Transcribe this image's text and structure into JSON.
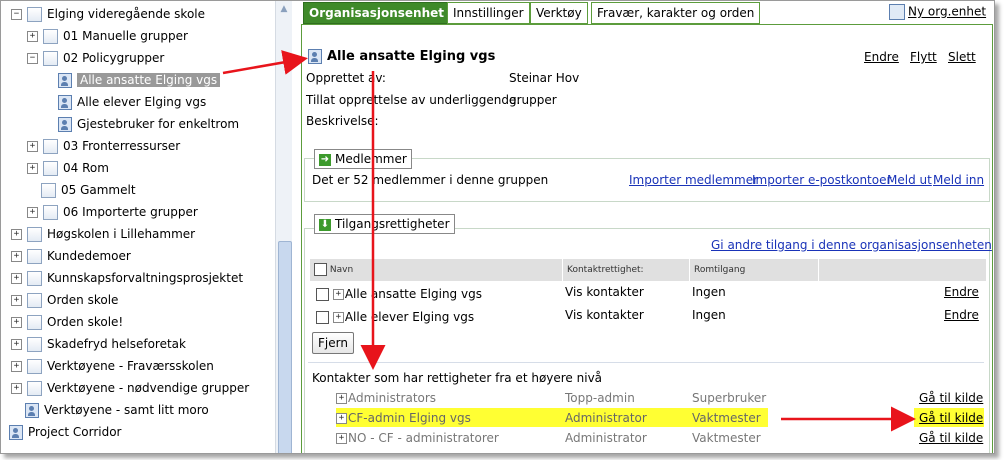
{
  "tree": {
    "items": [
      {
        "label": "Elging videregående skole",
        "toggle": "⊟",
        "icon": "folder-icon"
      },
      {
        "label": "01 Manuelle grupper",
        "toggle": "+",
        "icon": "folder-icon"
      },
      {
        "label": "02 Policygrupper",
        "toggle": "−",
        "icon": "folder-icon"
      },
      {
        "label": "Alle ansatte Elging vgs",
        "toggle": "",
        "icon": "user-group-icon",
        "selected": true
      },
      {
        "label": "Alle elever Elging vgs",
        "toggle": "",
        "icon": "user-group-icon"
      },
      {
        "label": "Gjestebruker for enkeltrom",
        "toggle": "",
        "icon": "user-group-icon"
      },
      {
        "label": "03 Fronterressurser",
        "toggle": "+",
        "icon": "folder-icon"
      },
      {
        "label": "04 Rom",
        "toggle": "+",
        "icon": "folder-icon"
      },
      {
        "label": "05 Gammelt",
        "toggle": "",
        "icon": "folder-icon"
      },
      {
        "label": "06 Importerte grupper",
        "toggle": "+",
        "icon": "folder-icon"
      },
      {
        "label": "Høgskolen i Lillehammer",
        "toggle": "+",
        "icon": "folder-icon"
      },
      {
        "label": "Kundedemoer",
        "toggle": "+",
        "icon": "folder-icon"
      },
      {
        "label": "Kunnskapsforvaltningsprosjektet",
        "toggle": "+",
        "icon": "folder-icon"
      },
      {
        "label": "Orden skole",
        "toggle": "+",
        "icon": "folder-icon"
      },
      {
        "label": "Orden skole!",
        "toggle": "+",
        "icon": "folder-icon"
      },
      {
        "label": "Skadefryd helseforetak",
        "toggle": "+",
        "icon": "folder-icon"
      },
      {
        "label": "Verktøyene - Fraværsskolen",
        "toggle": "+",
        "icon": "folder-icon"
      },
      {
        "label": "Verktøyene - nødvendige grupper",
        "toggle": "+",
        "icon": "folder-icon"
      },
      {
        "label": "Verktøyene - samt litt moro",
        "toggle": "",
        "icon": "org-icon"
      },
      {
        "label": "Project Corridor",
        "toggle": "",
        "icon": "org-icon"
      }
    ]
  },
  "tabs": [
    {
      "label": "Organisasjonsenhet",
      "active": true
    },
    {
      "label": "Innstillinger",
      "active": false
    },
    {
      "label": "Verktøy",
      "active": false
    },
    {
      "label": "Fravær, karakter og orden",
      "active": false
    }
  ],
  "new_org_label": "Ny org.enhet",
  "group": {
    "title": "Alle ansatte Elging vgs",
    "actions": [
      "Endre",
      "Flytt",
      "Slett"
    ],
    "created_by_label": "Opprettet av:",
    "created_by_value": "Steinar Hov",
    "allow_sub_label": "Tillat opprettelse av underliggende:",
    "allow_sub_value": "grupper",
    "description_label": "Beskrivelse:"
  },
  "members": {
    "legend": "Medlemmer",
    "count_text": "Det er 52 medlemmer i denne gruppen",
    "links": [
      "Importer medlemmer",
      "Importer e-postkontoer",
      "Meld ut",
      "Meld inn"
    ]
  },
  "access": {
    "legend": "Tilgangsrettigheter",
    "give_link": "Gi andre tilgang i denne organisasjonsenheten",
    "columns": [
      "Navn",
      "Kontaktrettighet:",
      "Romtilgang"
    ],
    "rows": [
      {
        "name": "Alle ansatte Elging vgs",
        "contact": "Vis kontakter",
        "room": "Ingen",
        "action": "Endre"
      },
      {
        "name": "Alle elever Elging vgs",
        "contact": "Vis kontakter",
        "room": "Ingen",
        "action": "Endre"
      }
    ],
    "remove_button": "Fjern",
    "inherited_title": "Kontakter som har rettigheter fra et høyere nivå",
    "inherited": [
      {
        "name": "Administrators",
        "contact": "Topp-admin",
        "room": "Superbruker",
        "action": "Gå til kilde",
        "highlight": false
      },
      {
        "name": "CF-admin Elging vgs",
        "contact": "Administrator",
        "room": "Vaktmester",
        "action": "Gå til kilde",
        "highlight": true
      },
      {
        "name": "NO - CF - administratorer",
        "contact": "Administrator",
        "room": "Vaktmester",
        "action": "Gå til kilde",
        "highlight": false
      }
    ]
  },
  "colors": {
    "tab_active": "#3f8a2a",
    "highlight": "#ffff33",
    "annotation_arrow": "#e8141b",
    "link_blue": "#1a33b8"
  }
}
